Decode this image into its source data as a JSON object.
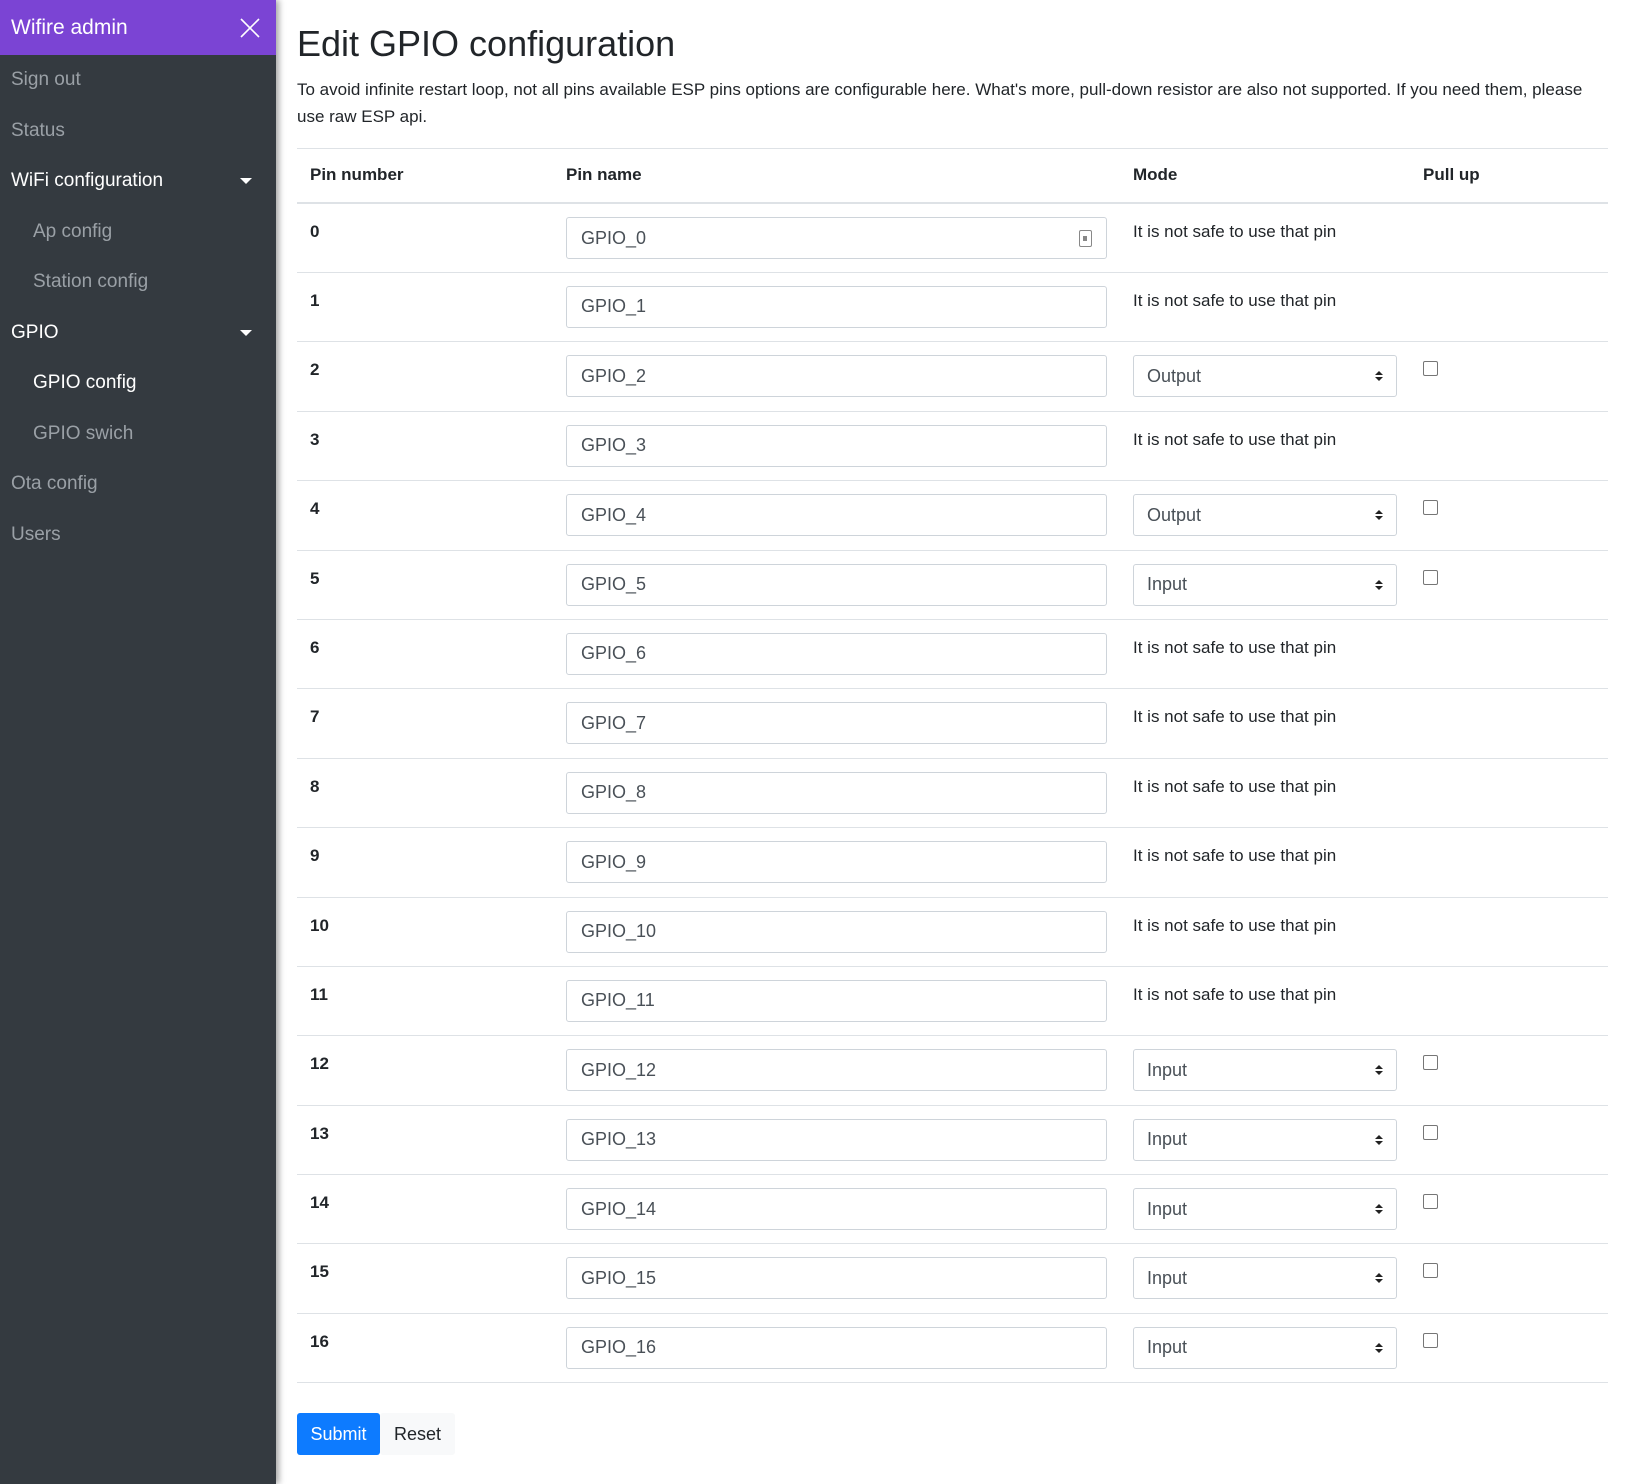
{
  "sidebar": {
    "brand": "Wifire admin",
    "items": [
      {
        "label": "Sign out"
      },
      {
        "label": "Status"
      },
      {
        "label": "WiFi configuration"
      },
      {
        "label": "Ap config"
      },
      {
        "label": "Station config"
      },
      {
        "label": "GPIO"
      },
      {
        "label": "GPIO config"
      },
      {
        "label": "GPIO swich"
      },
      {
        "label": "Ota config"
      },
      {
        "label": "Users"
      }
    ]
  },
  "main": {
    "title": "Edit GPIO configuration",
    "intro": "To avoid infinite restart loop, not all pins available ESP pins options are configurable here. What's more, pull-down resistor are also not supported. If you need them, please use raw ESP api.",
    "headers": {
      "pin_number": "Pin number",
      "pin_name": "Pin name",
      "mode": "Mode",
      "pull_up": "Pull up"
    },
    "rows": [
      {
        "pin": "0",
        "name": "GPIO_0",
        "mode": "It is not safe to use that pin"
      },
      {
        "pin": "1",
        "name": "GPIO_1",
        "mode": "It is not safe to use that pin"
      },
      {
        "pin": "2",
        "name": "GPIO_2",
        "mode": "Output"
      },
      {
        "pin": "3",
        "name": "GPIO_3",
        "mode": "It is not safe to use that pin"
      },
      {
        "pin": "4",
        "name": "GPIO_4",
        "mode": "Output"
      },
      {
        "pin": "5",
        "name": "GPIO_5",
        "mode": "Input"
      },
      {
        "pin": "6",
        "name": "GPIO_6",
        "mode": "It is not safe to use that pin"
      },
      {
        "pin": "7",
        "name": "GPIO_7",
        "mode": "It is not safe to use that pin"
      },
      {
        "pin": "8",
        "name": "GPIO_8",
        "mode": "It is not safe to use that pin"
      },
      {
        "pin": "9",
        "name": "GPIO_9",
        "mode": "It is not safe to use that pin"
      },
      {
        "pin": "10",
        "name": "GPIO_10",
        "mode": "It is not safe to use that pin"
      },
      {
        "pin": "11",
        "name": "GPIO_11",
        "mode": "It is not safe to use that pin"
      },
      {
        "pin": "12",
        "name": "GPIO_12",
        "mode": "Input"
      },
      {
        "pin": "13",
        "name": "GPIO_13",
        "mode": "Input"
      },
      {
        "pin": "14",
        "name": "GPIO_14",
        "mode": "Input"
      },
      {
        "pin": "15",
        "name": "GPIO_15",
        "mode": "Input"
      },
      {
        "pin": "16",
        "name": "GPIO_16",
        "mode": "Input"
      }
    ],
    "submit_label": "Submit",
    "reset_label": "Reset"
  },
  "colors": {
    "sidebar_bg": "#343a40",
    "header_bg": "#7b44d4",
    "primary": "#0d7bff"
  }
}
